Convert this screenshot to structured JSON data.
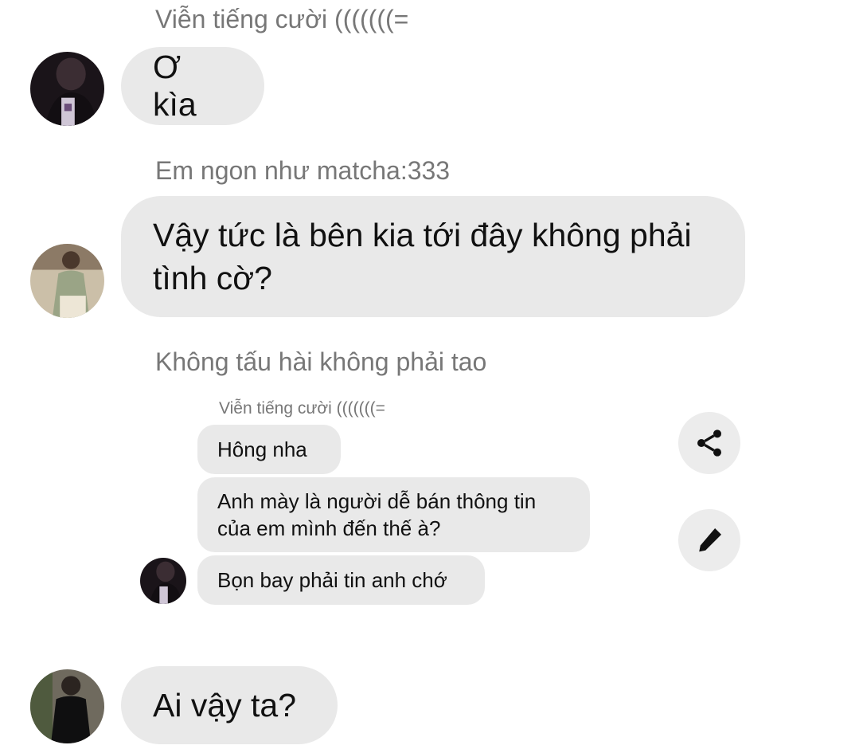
{
  "messages": [
    {
      "sender": "Viễn tiếng cười (((((((=",
      "text": "Ơ kìa",
      "avatar": "avatar-dark-portrait"
    },
    {
      "sender": "Em ngon như matcha:333",
      "text": "Vậy tức là bên kia tới đây không phải tình cờ?",
      "avatar": "avatar-light-outfit"
    },
    {
      "sender": "Không tấu hài không phải tao",
      "quoted": {
        "sender": "Viễn tiếng cười (((((((=",
        "lines": [
          "Hông nha",
          "Anh mày là người dễ bán thông tin của em mình đến thế à?",
          "Bọn bay phải tin anh chớ"
        ],
        "avatar": "avatar-dark-portrait"
      }
    },
    {
      "sender": "",
      "text": "Ai vậy ta?",
      "avatar": "avatar-black-outfit"
    }
  ],
  "actions": {
    "share_icon": "share-icon",
    "edit_icon": "pencil-icon"
  },
  "colors": {
    "bubble": "#e9e9e9",
    "sender_text": "#777777",
    "action_bg": "#ececec"
  }
}
